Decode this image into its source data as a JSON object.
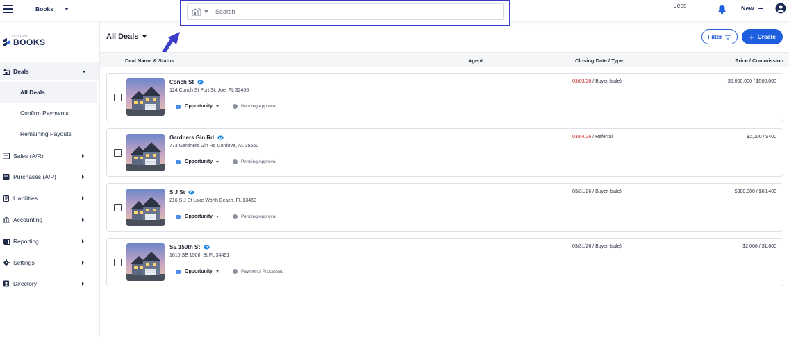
{
  "topbar": {
    "app_name": "Books",
    "search_placeholder": "Search",
    "user_name": "Jess",
    "new_label": "New",
    "new_plus": "+"
  },
  "sidebar": {
    "logo_word": "BOOKS",
    "logo_tagline": "SKYSLOPE",
    "deals_label": "Deals",
    "deals_subitems": [
      "All Deals",
      "Confirm Payments",
      "Remaining Payouts"
    ],
    "items": [
      {
        "label": "Sales (A/R)",
        "icon": "sales-icon"
      },
      {
        "label": "Purchases (A/P)",
        "icon": "purchases-icon"
      },
      {
        "label": "Liabilities",
        "icon": "liabilities-icon"
      },
      {
        "label": "Accounting",
        "icon": "bank-icon"
      },
      {
        "label": "Reporting",
        "icon": "reporting-icon"
      },
      {
        "label": "Settings",
        "icon": "gear-icon"
      },
      {
        "label": "Directory",
        "icon": "directory-icon"
      }
    ]
  },
  "main": {
    "view_title": "All Deals",
    "filter_label": "Filter",
    "create_label": "Create",
    "create_plus": "+",
    "columns": {
      "deal": "Deal Name & Status",
      "agent": "Agent",
      "closing": "Closing Date / Type",
      "price": "Price / Commission"
    },
    "deals": [
      {
        "name": "Conch St",
        "address": "124 Conch St Port St. Joe, FL 32456",
        "stage": "Opportunity",
        "status": "Pending Approval",
        "closing_date": "03/03/26",
        "closing_date_overdue": true,
        "closing_type": " / Buyer (sale)",
        "price": "$5,000,000 / $500,000"
      },
      {
        "name": "Gardners Gin Rd",
        "address": "773 Gardners Gin Rd Cordova, AL 35550",
        "stage": "Opportunity",
        "status": "Pending Approval",
        "closing_date": "03/04/26",
        "closing_date_overdue": true,
        "closing_type": " / Referral",
        "price": "$2,000 / $400"
      },
      {
        "name": "S J St",
        "address": "216 S J St Lake Worth Beach, FL 33460",
        "stage": "Opportunity",
        "status": "Pending Approval",
        "closing_date": "03/31/26",
        "closing_date_overdue": false,
        "closing_type": " / Buyer (sale)",
        "price": "$300,000 / $60,400"
      },
      {
        "name": "SE 150th St",
        "address": "1610 SE 150th St FL 34491",
        "stage": "Opportunity",
        "status": "Payments Processed",
        "closing_date": "03/31/26",
        "closing_date_overdue": false,
        "closing_type": " / Buyer (sale)",
        "price": "$2,000 / $1,000"
      }
    ]
  },
  "colors": {
    "accent": "#1e5fe0",
    "annotation": "#3d3cc6",
    "overdue": "#c62828",
    "navy": "#1b2b55"
  }
}
